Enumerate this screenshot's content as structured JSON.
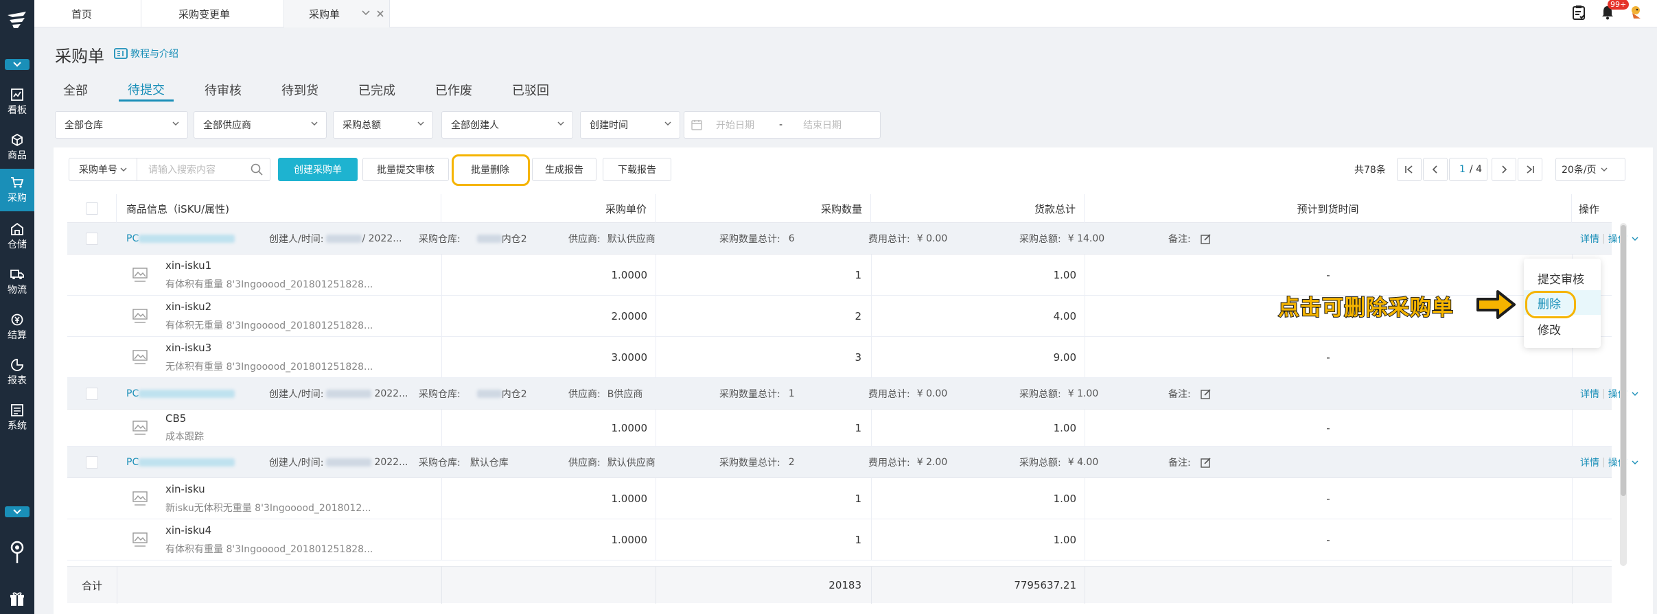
{
  "nav": {
    "items": [
      {
        "label": "看板",
        "icon": "dashboard-icon"
      },
      {
        "label": "商品",
        "icon": "cube-icon"
      },
      {
        "label": "采购",
        "icon": "cart-icon"
      },
      {
        "label": "仓储",
        "icon": "warehouse-icon"
      },
      {
        "label": "物流",
        "icon": "truck-icon"
      },
      {
        "label": "结算",
        "icon": "coin-icon"
      },
      {
        "label": "报表",
        "icon": "chart-icon"
      },
      {
        "label": "系统",
        "icon": "system-icon"
      }
    ],
    "active": "采购"
  },
  "topbar": {
    "tabs": [
      {
        "label": "首页"
      },
      {
        "label": "采购变更单"
      },
      {
        "label": "采购单"
      }
    ],
    "notification_badge": "99+"
  },
  "page": {
    "title": "采购单",
    "tutorial_link": "教程与介绍",
    "status_tabs": [
      "全部",
      "待提交",
      "待审核",
      "待到货",
      "已完成",
      "已作废",
      "已驳回"
    ],
    "active_tab": "待提交"
  },
  "filters": {
    "warehouse": "全部仓库",
    "supplier": "全部供应商",
    "total_amount": "采购总额",
    "creator": "全部创建人",
    "time_type": "创建时间",
    "start_date_placeholder": "开始日期",
    "date_separator": "-",
    "end_date_placeholder": "结束日期"
  },
  "toolbar": {
    "search_field": "采购单号",
    "search_placeholder": "请输入搜索内容",
    "create": "创建采购单",
    "batch_submit": "批量提交审核",
    "batch_delete": "批量删除",
    "gen_report": "生成报告",
    "download_report": "下载报告"
  },
  "pagination": {
    "total": "共78条",
    "current": "1",
    "pages": "/ 4",
    "page_size": "20条/页"
  },
  "table": {
    "headers": {
      "product": "商品信息（iSKU/属性)",
      "unit_price": "采购单价",
      "quantity": "采购数量",
      "subtotal": "货款总计",
      "eta": "预计到货时间",
      "actions": "操作"
    },
    "groups": [
      {
        "po_prefix": "PC",
        "creator_label": "创建人/时间:",
        "creator_suffix": "/ 2022...",
        "warehouse_label": "采购仓库:",
        "warehouse": "内仓2",
        "supplier_label": "供应商:",
        "supplier": "默认供应商",
        "qty_label": "采购数量总计:",
        "qty_total": "6",
        "fee_label": "费用总计:",
        "fee_total": "¥ 0.00",
        "amount_label": "采购总额:",
        "amount_total": "¥ 14.00",
        "remark_label": "备注:",
        "detail": "详情",
        "op": "操作",
        "items": [
          {
            "sku": "xin-isku1",
            "attr": "有体积有重量 8'3Ingooood_201801251828...",
            "price": "1.0000",
            "qty": "1",
            "subtotal": "1.00",
            "eta": "-"
          },
          {
            "sku": "xin-isku2",
            "attr": "有体积无重量 8'3Ingooood_201801251828...",
            "price": "2.0000",
            "qty": "2",
            "subtotal": "4.00",
            "eta": "-"
          },
          {
            "sku": "xin-isku3",
            "attr": "无体积有重量 8'3Ingooood_201801251828...",
            "price": "3.0000",
            "qty": "3",
            "subtotal": "9.00",
            "eta": "-"
          }
        ]
      },
      {
        "po_prefix": "PC",
        "creator_label": "创建人/时间:",
        "creator_suffix": "2022...",
        "warehouse_label": "采购仓库:",
        "warehouse": "内仓2",
        "supplier_label": "供应商:",
        "supplier": "B供应商",
        "qty_label": "采购数量总计:",
        "qty_total": "1",
        "fee_label": "费用总计:",
        "fee_total": "¥ 0.00",
        "amount_label": "采购总额:",
        "amount_total": "¥ 1.00",
        "remark_label": "备注:",
        "detail": "详情",
        "op": "操作",
        "items": [
          {
            "sku": "CB5",
            "attr": "成本跟踪",
            "price": "1.0000",
            "qty": "1",
            "subtotal": "1.00",
            "eta": "-"
          }
        ]
      },
      {
        "po_prefix": "PC",
        "creator_label": "创建人/时间:",
        "creator_suffix": "2022...",
        "warehouse_label": "采购仓库:",
        "warehouse": "默认仓库",
        "supplier_label": "供应商:",
        "supplier": "默认供应商",
        "qty_label": "采购数量总计:",
        "qty_total": "2",
        "fee_label": "费用总计:",
        "fee_total": "¥ 2.00",
        "amount_label": "采购总额:",
        "amount_total": "¥ 4.00",
        "remark_label": "备注:",
        "detail": "详情",
        "op": "操作",
        "items": [
          {
            "sku": "xin-isku",
            "attr": "新isku无体积无重量 8'3Ingooood_2018012...",
            "price": "1.0000",
            "qty": "1",
            "subtotal": "1.00",
            "eta": "-"
          },
          {
            "sku": "xin-isku4",
            "attr": "有体积有重量 8'3Ingooood_201801251828...",
            "price": "1.0000",
            "qty": "1",
            "subtotal": "1.00",
            "eta": "-"
          }
        ]
      }
    ],
    "footer": {
      "label": "合计",
      "qty_sum": "20183",
      "amount_sum": "7795637.21"
    }
  },
  "dropdown_menu": {
    "items": [
      "提交审核",
      "删除",
      "修改"
    ],
    "hovered": "删除"
  },
  "annotation": "点击可删除采购单",
  "colors": {
    "accent": "#1a8fb8",
    "primary_button": "#1eb3d0",
    "sidebar": "#1e2b3a",
    "highlight": "#f5b400"
  }
}
